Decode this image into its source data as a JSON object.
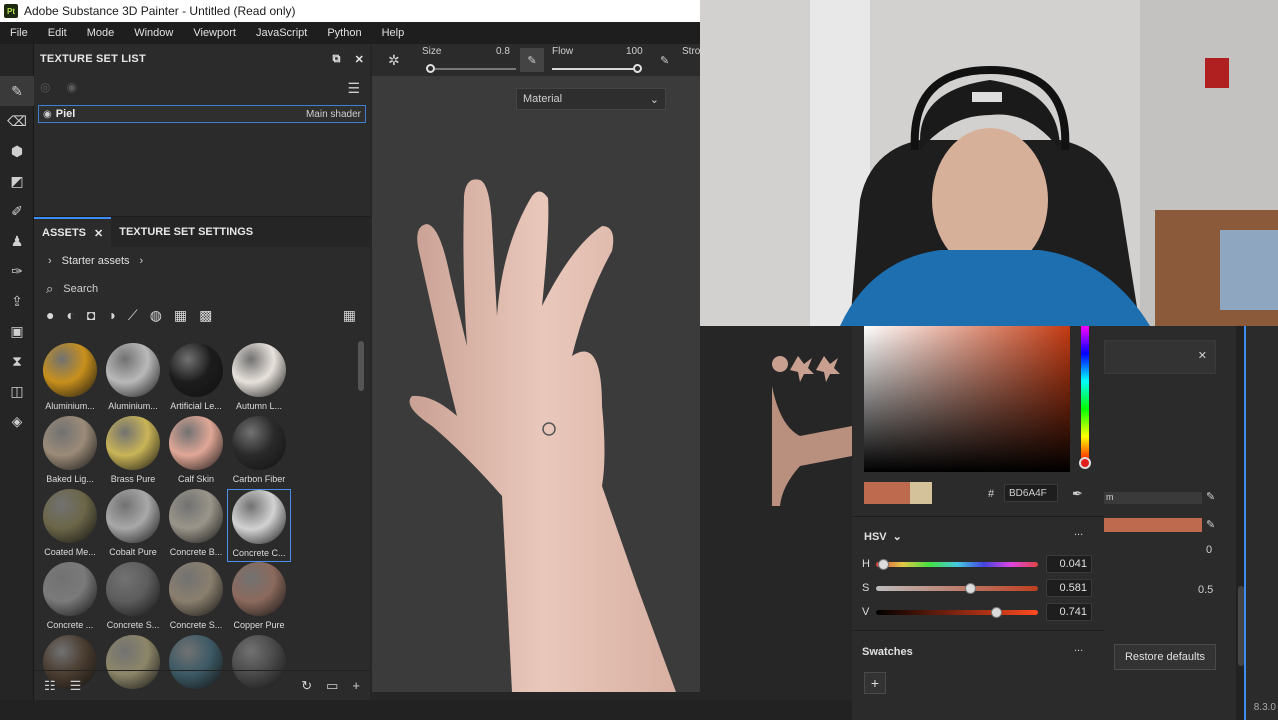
{
  "window": {
    "title": "Adobe Substance 3D Painter - Untitled (Read only)",
    "logo": "Pt"
  },
  "menu": [
    "File",
    "Edit",
    "Mode",
    "Window",
    "Viewport",
    "JavaScript",
    "Python",
    "Help"
  ],
  "toolbar": {
    "size_label": "Size",
    "size_value": "0.8",
    "flow_label": "Flow",
    "flow_value": "100",
    "stroke_label": "Stro"
  },
  "texture_set_list": {
    "title": "TEXTURE SET LIST",
    "item_name": "Piel",
    "item_shader": "Main shader"
  },
  "assets": {
    "tab_assets": "ASSETS",
    "tab_tss": "TEXTURE SET SETTINGS",
    "breadcrumb": "Starter assets",
    "search_placeholder": "Search",
    "items": [
      {
        "label": "Aluminium...",
        "color": "#c8901c"
      },
      {
        "label": "Aluminium...",
        "color": "#b9b9b9"
      },
      {
        "label": "Artificial Le...",
        "color": "#1c1c1c"
      },
      {
        "label": "Autumn L...",
        "color": "#e8e2dc"
      },
      {
        "label": "Baked Lig...",
        "color": "#9b8b78"
      },
      {
        "label": "Brass Pure",
        "color": "#c9b457"
      },
      {
        "label": "Calf Skin",
        "color": "#e0a796"
      },
      {
        "label": "Carbon Fiber",
        "color": "#2a2a2a"
      },
      {
        "label": "Coated Me...",
        "color": "#6b6648"
      },
      {
        "label": "Cobalt Pure",
        "color": "#a8a8a8"
      },
      {
        "label": "Concrete B...",
        "color": "#9a958a"
      },
      {
        "label": "Concrete C...",
        "color": "#d2d2d2"
      },
      {
        "label": "Concrete ...",
        "color": "#7a7a7a"
      },
      {
        "label": "Concrete S...",
        "color": "#5d5d5d"
      },
      {
        "label": "Concrete S...",
        "color": "#8a7f6e"
      },
      {
        "label": "Copper Pure",
        "color": "#8c6a5d"
      },
      {
        "label": "",
        "color": "#4a3c30"
      },
      {
        "label": "",
        "color": "#8d8669"
      },
      {
        "label": "",
        "color": "#3d5a66"
      },
      {
        "label": "",
        "color": "#4a4a4a"
      }
    ]
  },
  "viewport": {
    "mode_select": "Material"
  },
  "color_picker": {
    "hex_prefix": "#",
    "hex_value": "BD6A4F",
    "current_color": "#bd6a4f",
    "previous_color": "#d4c39a",
    "mode": "HSV",
    "h_label": "H",
    "h_value": "0.041",
    "h_fraction": 0.041,
    "s_label": "S",
    "s_value": "0.581",
    "s_fraction": 0.581,
    "v_label": "V",
    "v_value": "0.741",
    "v_fraction": 0.741,
    "swatches_label": "Swatches",
    "more": "..."
  },
  "right_panel": {
    "value_zero": "0",
    "value_half": "0.5",
    "restore_label": "Restore defaults",
    "field_suffix": "m",
    "version": "8.3.0"
  }
}
